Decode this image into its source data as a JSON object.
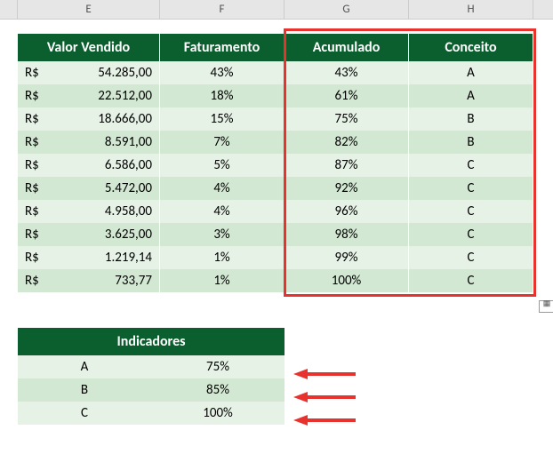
{
  "columns": {
    "E": "E",
    "F": "F",
    "G": "G",
    "H": "H"
  },
  "headers": {
    "valor": "Valor Vendido",
    "fatur": "Faturamento",
    "acum": "Acumulado",
    "conc": "Conceito"
  },
  "currency": "R$",
  "rows": [
    {
      "valor": "54.285,00",
      "fatur": "43%",
      "acum": "43%",
      "conc": "A"
    },
    {
      "valor": "22.512,00",
      "fatur": "18%",
      "acum": "61%",
      "conc": "A"
    },
    {
      "valor": "18.666,00",
      "fatur": "15%",
      "acum": "75%",
      "conc": "B"
    },
    {
      "valor": "8.591,00",
      "fatur": "7%",
      "acum": "82%",
      "conc": "B"
    },
    {
      "valor": "6.586,00",
      "fatur": "5%",
      "acum": "87%",
      "conc": "C"
    },
    {
      "valor": "5.472,00",
      "fatur": "4%",
      "acum": "92%",
      "conc": "C"
    },
    {
      "valor": "4.958,00",
      "fatur": "4%",
      "acum": "96%",
      "conc": "C"
    },
    {
      "valor": "3.625,00",
      "fatur": "3%",
      "acum": "98%",
      "conc": "C"
    },
    {
      "valor": "1.219,14",
      "fatur": "1%",
      "acum": "99%",
      "conc": "C"
    },
    {
      "valor": "733,77",
      "fatur": "1%",
      "acum": "100%",
      "conc": "C"
    }
  ],
  "indicadores": {
    "title": "Indicadores",
    "items": [
      {
        "label": "A",
        "value": "75%"
      },
      {
        "label": "B",
        "value": "85%"
      },
      {
        "label": "C",
        "value": "100%"
      }
    ]
  },
  "chart_data": {
    "type": "table",
    "title": "Valor Vendido / Faturamento / Acumulado / Conceito",
    "columns": [
      "Valor Vendido (R$)",
      "Faturamento",
      "Acumulado",
      "Conceito"
    ],
    "rows": [
      [
        54285.0,
        0.43,
        0.43,
        "A"
      ],
      [
        22512.0,
        0.18,
        0.61,
        "A"
      ],
      [
        18666.0,
        0.15,
        0.75,
        "B"
      ],
      [
        8591.0,
        0.07,
        0.82,
        "B"
      ],
      [
        6586.0,
        0.05,
        0.87,
        "C"
      ],
      [
        5472.0,
        0.04,
        0.92,
        "C"
      ],
      [
        4958.0,
        0.04,
        0.96,
        "C"
      ],
      [
        3625.0,
        0.03,
        0.98,
        "C"
      ],
      [
        1219.14,
        0.01,
        0.99,
        "C"
      ],
      [
        733.77,
        0.01,
        1.0,
        "C"
      ]
    ],
    "indicators": {
      "A": 0.75,
      "B": 0.85,
      "C": 1.0
    }
  }
}
